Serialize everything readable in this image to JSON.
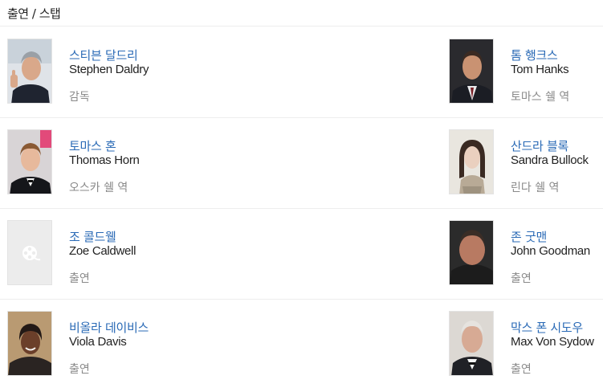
{
  "section": {
    "title": "출연 / 스탭"
  },
  "cast": [
    {
      "name_ko": "스티븐 달드리",
      "name_en": "Stephen Daldry",
      "role": "감독",
      "photo": "photo"
    },
    {
      "name_ko": "톰 행크스",
      "name_en": "Tom Hanks",
      "role": "토마스 쉘 역",
      "photo": "photo"
    },
    {
      "name_ko": "토마스 혼",
      "name_en": "Thomas Horn",
      "role": "오스카 쉘 역",
      "photo": "photo"
    },
    {
      "name_ko": "산드라 블록",
      "name_en": "Sandra Bullock",
      "role": "린다 쉘 역",
      "photo": "photo"
    },
    {
      "name_ko": "조 콜드웰",
      "name_en": "Zoe Caldwell",
      "role": "출연",
      "photo": "placeholder-film-reel-icon"
    },
    {
      "name_ko": "존 굿맨",
      "name_en": "John Goodman",
      "role": "출연",
      "photo": "photo"
    },
    {
      "name_ko": "비올라 데이비스",
      "name_en": "Viola Davis",
      "role": "출연",
      "photo": "photo"
    },
    {
      "name_ko": "막스 폰 시도우",
      "name_en": "Max Von Sydow",
      "role": "출연",
      "photo": "photo"
    }
  ],
  "colors": {
    "name_link": "#2a6ab6",
    "role_text": "#8a8a8a",
    "divider": "#ededed"
  }
}
